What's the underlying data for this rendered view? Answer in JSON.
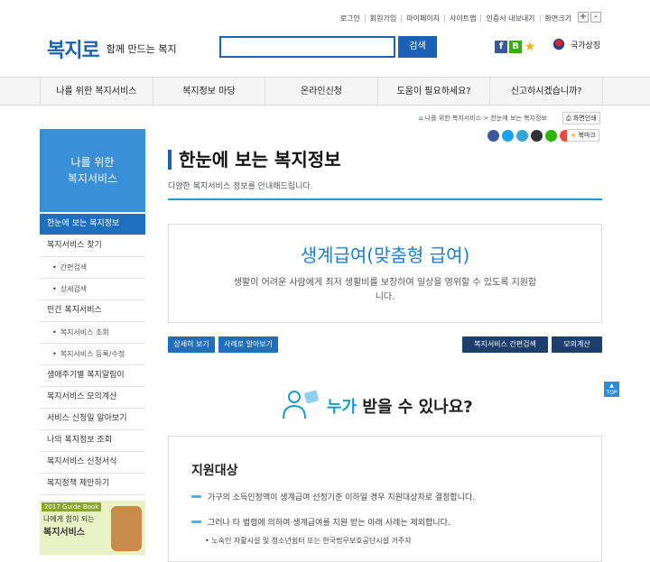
{
  "utility": {
    "links": [
      "로그인",
      "회원가입",
      "마이페이지",
      "사이트맵",
      "인증서 내보내기",
      "화면크기"
    ],
    "zoom_in": "+",
    "zoom_out": "-"
  },
  "header": {
    "logo": "복지로",
    "tagline": "함께 만드는 복지",
    "search_placeholder": "",
    "search_button": "검색",
    "national_symbol": "국가상징"
  },
  "gnb": [
    "나를 위한 복지서비스",
    "복지정보 마당",
    "온라인신청",
    "도움이 필요하세요?",
    "신고하시겠습니까?"
  ],
  "breadcrumb": "나를 위한 복지서비스 > 한눈에 보는 복지정보",
  "print_label": "화면인쇄",
  "bookmark_label": "북마크",
  "lnb": {
    "title_line1": "나를 위한",
    "title_line2": "복지서비스",
    "items": [
      {
        "label": "한눈에 보는 복지정보",
        "type": "active"
      },
      {
        "label": "복지서비스 찾기",
        "type": "main"
      },
      {
        "label": "간편검색",
        "type": "sub"
      },
      {
        "label": "상세검색",
        "type": "sub"
      },
      {
        "label": "민간 복지서비스",
        "type": "main"
      },
      {
        "label": "복지서비스 조회",
        "type": "sub"
      },
      {
        "label": "복지서비스 등록/수정",
        "type": "sub"
      },
      {
        "label": "생애주기별 복지알림이",
        "type": "main"
      },
      {
        "label": "복지서비스 모의계산",
        "type": "main"
      },
      {
        "label": "서비스 신청일 알아보기",
        "type": "main"
      },
      {
        "label": "나의 복지정보 조회",
        "type": "main"
      },
      {
        "label": "복지서비스 신청서식",
        "type": "main"
      },
      {
        "label": "복지정책 제안하기",
        "type": "main"
      }
    ]
  },
  "banner": {
    "tag": "2017 Guide Book",
    "line1": "나에게 힘이 되는",
    "line2": "복지서비스"
  },
  "page": {
    "title": "한눈에 보는 복지정보",
    "subtitle": "다양한 복지서비스 정보를 안내해드립니다."
  },
  "info": {
    "heading": "생계급여(맞춤형 급여)",
    "description": "생활이 어려운 사람에게 최저 생활비를 보장하여 일상을 영위할 수 있도록 지원합니다."
  },
  "buttons": {
    "detail": "상세히 보기",
    "cases": "사례로 알아보기",
    "simple_search": "복지서비스 간편검색",
    "simulate": "모의계산"
  },
  "top_button": "TOP",
  "who": {
    "highlight": "누가",
    "rest": " 받을 수 있나요?"
  },
  "card": {
    "title": "지원대상",
    "items": [
      "가구의 소득인정액이 생계급여 선정기준 이하일 경우 지원대상자로 결정합니다.",
      "그러나 타 법령에 의하여 생계급여를 지원 받는 아래 사례는 제외합니다."
    ],
    "sub_items": [
      "• 노숙인 자활시설 및 청소년쉼터 또는 한국법무보호공단시설 거주자"
    ]
  },
  "colors": {
    "brand": "#1a61b8",
    "accent": "#1a9bd0",
    "active_menu": "#1f6fbf",
    "dark_button": "#1d3f6e"
  }
}
